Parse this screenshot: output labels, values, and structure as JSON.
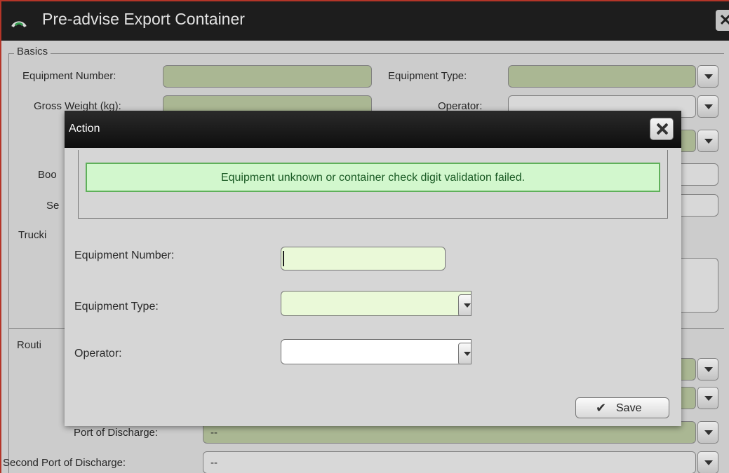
{
  "window": {
    "title": "Pre-advise Export Container",
    "close_glyph": "✕"
  },
  "basics": {
    "legend": "Basics",
    "equipment_number_label": "Equipment Number:",
    "equipment_type_label": "Equipment Type:",
    "gross_weight_label": "Gross Weight (kg):",
    "operator_label": "Operator:",
    "booking_label_partial": "Boo",
    "seal_label_partial": "Se",
    "trucking_label_partial": "Trucki"
  },
  "routing": {
    "legend_partial": "Routi",
    "port_of_discharge_label": "Port of Discharge:",
    "port_of_discharge_value": "--",
    "second_port_of_discharge_label": "Second Port of Discharge:",
    "second_port_of_discharge_value": "--"
  },
  "dialog": {
    "title": "Action",
    "message": "Equipment unknown or container check digit validation failed.",
    "equipment_number_label": "Equipment Number:",
    "equipment_number_value": "",
    "equipment_type_label": "Equipment Type:",
    "equipment_type_value": "",
    "operator_label": "Operator:",
    "operator_value": "",
    "save_label": "Save",
    "save_icon": "✔"
  },
  "colors": {
    "required_field": "#b5c39d",
    "dialog_required_field": "#eaf9d8",
    "message_background": "#d2f7cd",
    "message_border": "#5fb05a",
    "title_bar": "#1f1f1f"
  }
}
